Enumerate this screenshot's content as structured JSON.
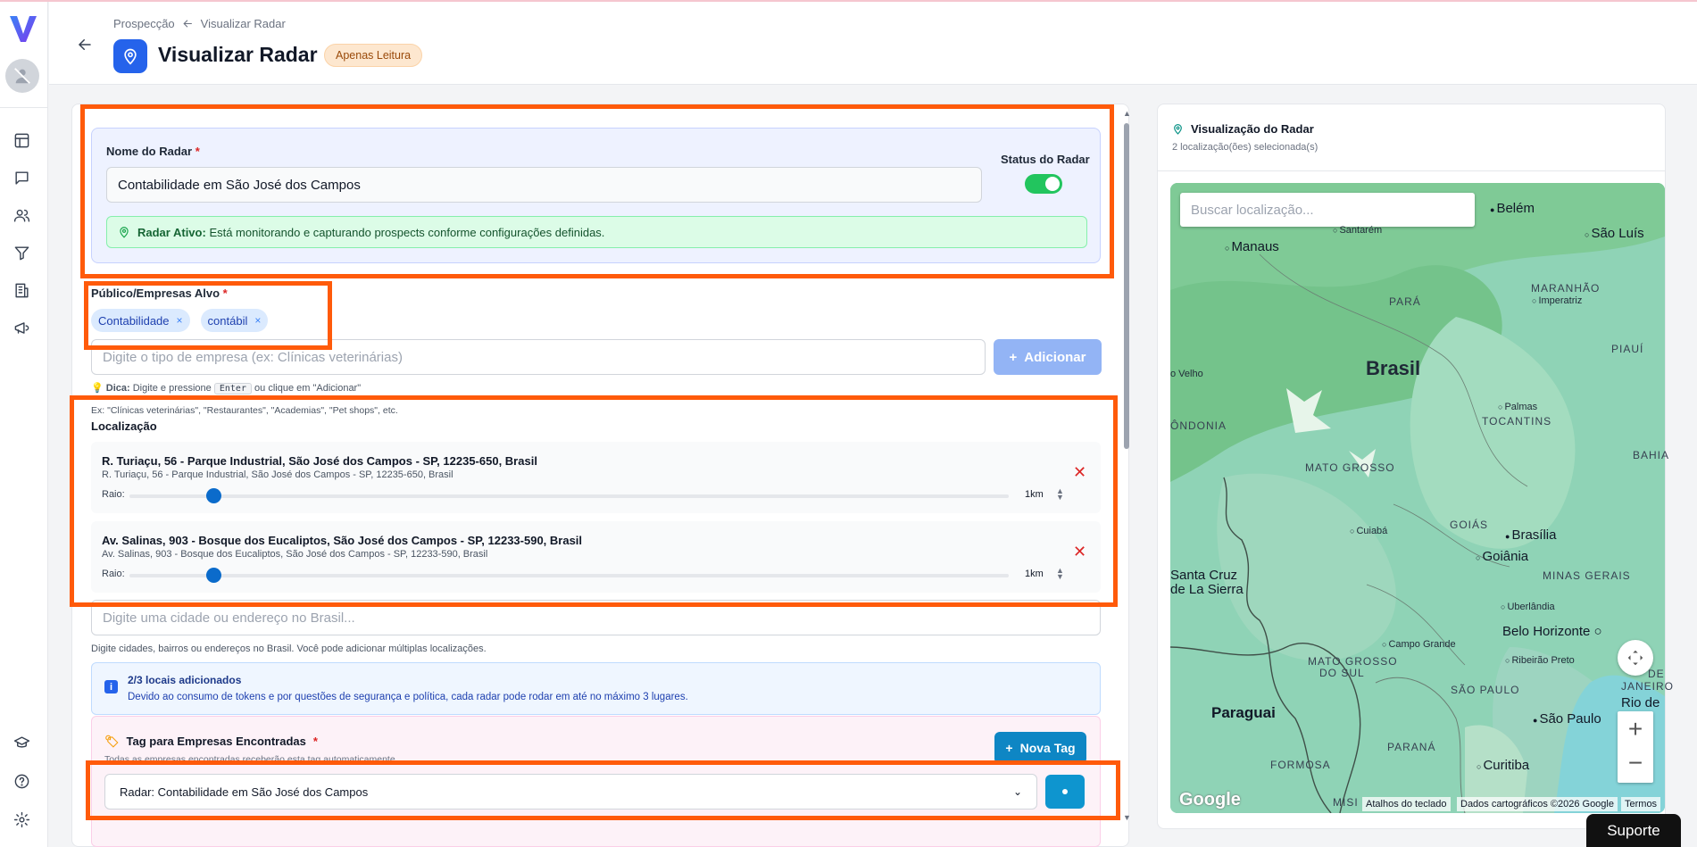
{
  "breadcrumb": {
    "parent": "Prospecção",
    "current": "Visualizar Radar"
  },
  "header": {
    "title": "Visualizar Radar",
    "badge": "Apenas Leitura"
  },
  "radar": {
    "name_label": "Nome do Radar",
    "required_mark": "*",
    "name_value": "Contabilidade em São José dos Campos",
    "status_label": "Status do Radar",
    "alert_strong": "Radar Ativo:",
    "alert_text": "Está monitorando e capturando prospects conforme configurações definidas."
  },
  "audience": {
    "label": "Público/Empresas Alvo",
    "tags": [
      "Contabilidade",
      "contábil"
    ],
    "remove_glyph": "×",
    "placeholder": "Digite o tipo de empresa (ex: Clínicas veterinárias)",
    "add_label": "Adicionar",
    "tip_strong": "Dica:",
    "tip_text1": "Digite e pressione",
    "tip_key": "Enter",
    "tip_text2": "ou clique em \"Adicionar\"",
    "examples": "Ex: \"Clínicas veterinárias\", \"Restaurantes\", \"Academias\", \"Pet shops\", etc."
  },
  "location": {
    "label": "Localização",
    "radius_label": "Raio:",
    "items": [
      {
        "title": "R. Turiaçu, 56 - Parque Industrial, São José dos Campos - SP, 12235-650, Brasil",
        "subtitle": "R. Turiaçu, 56 - Parque Industrial, São José dos Campos - SP, 12235-650, Brasil",
        "radius": "1km",
        "radius_fraction": 0.095
      },
      {
        "title": "Av. Salinas, 903 - Bosque dos Eucaliptos, São José dos Campos - SP, 12233-590, Brasil",
        "subtitle": "Av. Salinas, 903 - Bosque dos Eucaliptos, São José dos Campos - SP, 12233-590, Brasil",
        "radius": "1km",
        "radius_fraction": 0.095
      }
    ],
    "search_placeholder": "Digite uma cidade ou endereço no Brasil...",
    "help": "Digite cidades, bairros ou endereços no Brasil. Você pode adicionar múltiplas localizações.",
    "info_title": "2/3 locais adicionados",
    "info_text": "Devido ao consumo de tokens e por questões de segurança e política, cada radar pode rodar em até no máximo 3 lugares."
  },
  "tag": {
    "label": "Tag para Empresas Encontradas",
    "help": "Todas as empresas encontradas receberão esta tag automaticamente",
    "new_tag_label": "Nova Tag",
    "selected": "Radar: Contabilidade em São José dos Campos"
  },
  "map": {
    "title": "Visualização do Radar",
    "subtitle": "2 localização(ões) selecionada(s)",
    "search_placeholder": "Buscar localização...",
    "labels": {
      "belem": "Belém",
      "santarem": "Santarém",
      "manaus": "Manaus",
      "saoluis": "São Luís",
      "para": "PARÁ",
      "maranhao": "MARANHÃO",
      "imperatriz": "Imperatriz",
      "piaui": "PIAUÍ",
      "brasil": "Brasil",
      "velho": "o Velho",
      "palmas": "Palmas",
      "tocantins": "TOCANTINS",
      "ondonia": "ÔNDONIA",
      "mato_grosso": "MATO GROSSO",
      "bahia": "BAHIA",
      "cuiaba": "Cuiabá",
      "goias": "GOIÁS",
      "brasilia": "Brasília",
      "goiania": "Goiânia",
      "santa_cruz": "Santa Cruz",
      "la_sierra": "de La Sierra",
      "minas": "MINAS GERAIS",
      "uberlandia": "Uberlândia",
      "bh": "Belo Horizonte",
      "campo_grande": "Campo Grande",
      "ms1": "MATO GROSSO",
      "ms2": "DO SUL",
      "ribeirao": "Ribeirão Preto",
      "janeiro_a": "DE",
      "janeiro_b": "JANEIRO",
      "sao_paulo_state": "SÃO PAULO",
      "rio": "Rio de",
      "paraguai": "Paraguai",
      "sao_paulo": "São Paulo",
      "parana": "PARANÁ",
      "formosa": "FORMOSA",
      "curitiba": "Curitiba",
      "misi": "MISI"
    },
    "google": "Google",
    "keyboard": "Atalhos do teclado",
    "data": "Dados cartográficos ©2026 Google",
    "terms": "Termos",
    "zoom_in": "+",
    "zoom_out": "−"
  },
  "support": "Suporte",
  "colors": {
    "accent": "#2563eb",
    "highlight": "#ff5a0a",
    "toggle_on": "#22c55e"
  }
}
